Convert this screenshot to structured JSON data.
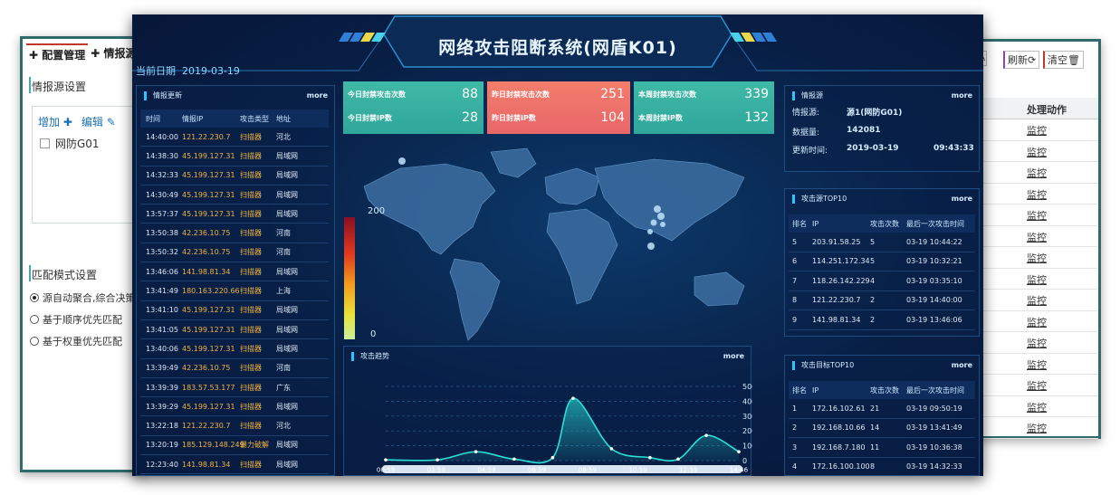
{
  "left_window": {
    "tabs": [
      "配置管理",
      "情报源"
    ],
    "section1_title": "情报源设置",
    "add_label": "增加",
    "edit_label": "编辑",
    "tree_item": "网防G01",
    "section2_title": "匹配模式设置",
    "radios": [
      {
        "label": "源自动聚合,综合决策",
        "checked": true
      },
      {
        "label": "基于顺序优先匹配",
        "checked": false
      },
      {
        "label": "基于权重优先匹配",
        "checked": false
      }
    ]
  },
  "right_window": {
    "refresh_label": "刷新",
    "clear_label": "清空",
    "column_header": "处理动作",
    "rows": [
      "监控",
      "监控",
      "监控",
      "监控",
      "监控",
      "监控",
      "监控",
      "监控",
      "监控",
      "监控",
      "监控",
      "监控",
      "监控",
      "监控",
      "监控"
    ]
  },
  "dashboard": {
    "title": "网络攻击阻断系统(网盾K01)",
    "date_label": "当前日期",
    "date_value": "2019-03-19",
    "intel_update": {
      "title": "情报更新",
      "more": "more",
      "headers": [
        "时间",
        "情报IP",
        "攻击类型",
        "地址"
      ],
      "rows": [
        [
          "14:40:00",
          "121.22.230.7",
          "扫描器",
          "河北"
        ],
        [
          "14:38:30",
          "45.199.127.31",
          "扫描器",
          "局域网"
        ],
        [
          "14:32:33",
          "45.199.127.31",
          "扫描器",
          "局域网"
        ],
        [
          "14:30:49",
          "45.199.127.31",
          "扫描器",
          "局域网"
        ],
        [
          "13:57:37",
          "45.199.127.31",
          "扫描器",
          "局域网"
        ],
        [
          "13:50:38",
          "42.236.10.75",
          "扫描器",
          "河南"
        ],
        [
          "13:50:32",
          "42.236.10.75",
          "扫描器",
          "河南"
        ],
        [
          "13:46:06",
          "141.98.81.34",
          "扫描器",
          "局域网"
        ],
        [
          "13:41:49",
          "180.163.220.66",
          "扫描器",
          "上海"
        ],
        [
          "13:41:10",
          "45.199.127.31",
          "扫描器",
          "局域网"
        ],
        [
          "13:41:05",
          "45.199.127.31",
          "扫描器",
          "局域网"
        ],
        [
          "13:40:06",
          "45.199.127.31",
          "扫描器",
          "局域网"
        ],
        [
          "13:39:49",
          "42.236.10.75",
          "扫描器",
          "河南"
        ],
        [
          "13:39:39",
          "183.57.53.177",
          "扫描器",
          "广东"
        ],
        [
          "13:39:29",
          "45.199.127.31",
          "扫描器",
          "局域网"
        ],
        [
          "13:22:18",
          "121.22.230.7",
          "扫描器",
          "河北"
        ],
        [
          "13:20:19",
          "185.129.148.249",
          "暴力破解",
          "局域网"
        ],
        [
          "12:23:40",
          "141.98.81.34",
          "扫描器",
          "局域网"
        ]
      ]
    },
    "stats": [
      {
        "l1": "今日封禁攻击次数",
        "v1": "88",
        "l2": "今日封禁IP数",
        "v2": "28",
        "color1": "#3fb9a7",
        "color2": "#2fa79b"
      },
      {
        "l1": "昨日封禁攻击次数",
        "v1": "251",
        "l2": "昨日封禁IP数",
        "v2": "104",
        "color1": "#f37d6a",
        "color2": "#e8666a"
      },
      {
        "l1": "本周封禁攻击次数",
        "v1": "339",
        "l2": "本周封禁IP数",
        "v2": "132",
        "color1": "#3fb9a7",
        "color2": "#2fa79b"
      }
    ],
    "legend": {
      "max": "200",
      "min": "0"
    },
    "trend": {
      "title": "攻击趋势",
      "more": "more"
    },
    "source_info": {
      "title": "情报源",
      "more": "more",
      "source_label": "情报源:",
      "source_value": "源1(网防G01)",
      "count_label": "数据量:",
      "count_value": "142081",
      "time_label": "更新时间:",
      "time_date": "2019-03-19",
      "time_clock": "09:43:33"
    },
    "src_top10": {
      "title": "攻击源TOP10",
      "more": "more",
      "headers": [
        "排名",
        "IP",
        "攻击次数",
        "最后一次攻击时间"
      ],
      "rows": [
        [
          "5",
          "203.91.58.25",
          "5",
          "03-19 10:44:22"
        ],
        [
          "6",
          "114.251.172.34",
          "5",
          "03-19 10:32:21"
        ],
        [
          "7",
          "118.26.142.229",
          "4",
          "03-19 03:35:10"
        ],
        [
          "8",
          "121.22.230.7",
          "2",
          "03-19 14:40:00"
        ],
        [
          "9",
          "141.98.81.34",
          "2",
          "03-19 13:46:06"
        ]
      ]
    },
    "dst_top10": {
      "title": "攻击目标TOP10",
      "more": "more",
      "headers": [
        "排名",
        "IP",
        "攻击次数",
        "最后一次攻击时间"
      ],
      "rows": [
        [
          "1",
          "172.16.102.61",
          "21",
          "03-19 09:50:19"
        ],
        [
          "2",
          "192.168.10.66",
          "14",
          "03-19 13:41:49"
        ],
        [
          "3",
          "192.168.7.180",
          "11",
          "03-19 10:36:38"
        ],
        [
          "4",
          "172.16.100.100",
          "8",
          "03-19 14:32:33"
        ]
      ]
    }
  },
  "chart_data": {
    "type": "area",
    "title": "攻击趋势",
    "x": [
      "00:59",
      "02:59",
      "04:59",
      "06:59",
      "08:59",
      "10:59",
      "12:59",
      "14:46"
    ],
    "series": [
      {
        "x_hours": [
          0.98,
          3.0,
          4.5,
          6.0,
          7.5,
          8.3,
          9.8,
          11.3,
          12.4,
          13.5,
          14.77
        ],
        "values": [
          5,
          5,
          60,
          10,
          20,
          420,
          80,
          20,
          10,
          170,
          60
        ]
      }
    ],
    "y_ticks": [
      0,
      100,
      200,
      300,
      400,
      500
    ],
    "ylim": [
      0,
      500
    ],
    "color": "#29e0d6",
    "grid": true
  }
}
